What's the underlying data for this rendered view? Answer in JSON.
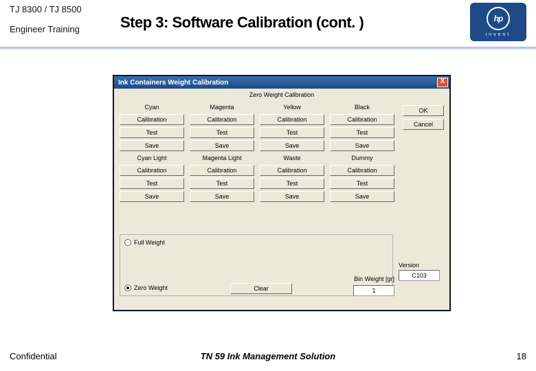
{
  "header": {
    "product": "TJ 8300 / TJ 8500",
    "subtitle": "Engineer  Training",
    "title": "Step 3: Software Calibration (cont. )",
    "logo_text": "hp",
    "logo_sub": "invent"
  },
  "window": {
    "title": "Ink Containers Weight Calibration",
    "subtitle": "Zero Weight Calibration",
    "close": "X",
    "right_buttons": {
      "ok": "OK",
      "cancel": "Cancel"
    },
    "columns": [
      {
        "head": "Cyan",
        "b1": "Calibration",
        "b2": "Test",
        "b3": "Save",
        "head2": "Cyan Light",
        "b4": "Calibration",
        "b5": "Test",
        "b6": "Save"
      },
      {
        "head": "Magenta",
        "b1": "Calibration",
        "b2": "Test",
        "b3": "Save",
        "head2": "Magenta Light",
        "b4": "Calibration",
        "b5": "Test",
        "b6": "Save"
      },
      {
        "head": "Yellow",
        "b1": "Calibration",
        "b2": "Test",
        "b3": "Save",
        "head2": "Waste",
        "b4": "Calibration",
        "b5": "Test",
        "b6": "Save"
      },
      {
        "head": "Black",
        "b1": "Calibration",
        "b2": "Test",
        "b3": "Save",
        "head2": "Dummy",
        "b4": "Calibration",
        "b5": "Test",
        "b6": "Save"
      }
    ],
    "radios": {
      "full": "Full Weight",
      "zero": "Zero Weight"
    },
    "clear": "Clear",
    "bw_label": "Bin Weight [gr]",
    "bw_value": "1",
    "version_label": "Version",
    "version_value": "C103"
  },
  "footer": {
    "left": "Confidential",
    "center": "TN 59 Ink Management Solution",
    "page": "18"
  }
}
